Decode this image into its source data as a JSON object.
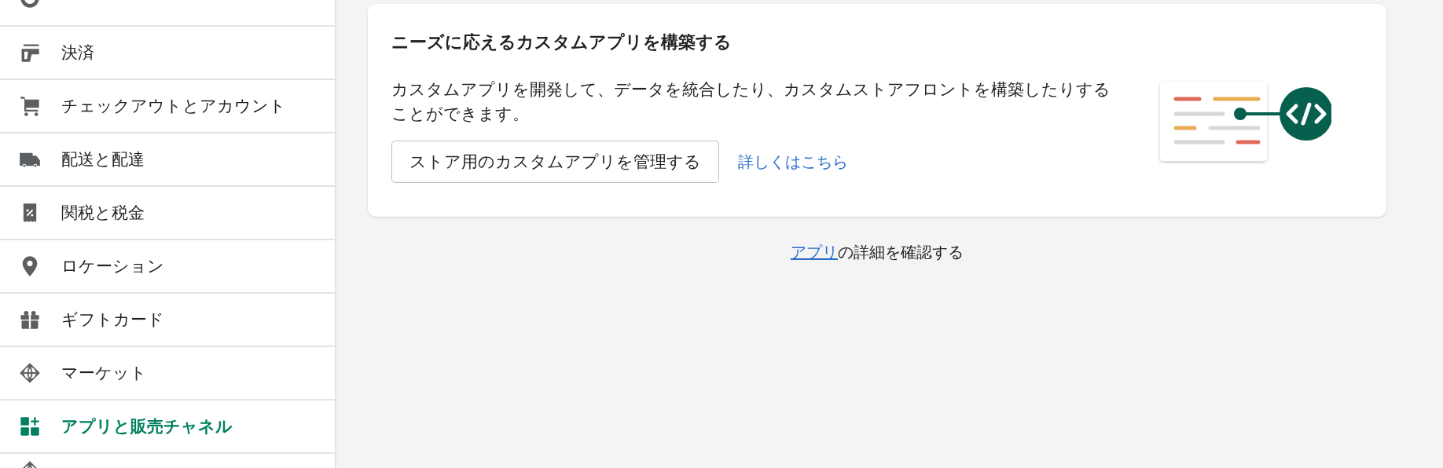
{
  "sidebar": {
    "items": [
      {
        "kind": "user"
      },
      {
        "kind": "card",
        "label": "決済",
        "selected": false
      },
      {
        "kind": "cart",
        "label": "チェックアウトとアカウント",
        "selected": false
      },
      {
        "kind": "truck",
        "label": "配送と配達",
        "selected": false
      },
      {
        "kind": "receipt",
        "label": "関税と税金",
        "selected": false
      },
      {
        "kind": "pin",
        "label": "ロケーション",
        "selected": false
      },
      {
        "kind": "gift",
        "label": "ギフトカード",
        "selected": false
      },
      {
        "kind": "globe",
        "label": "マーケット",
        "selected": false
      },
      {
        "kind": "apps",
        "label": "アプリと販売チャネル",
        "selected": true
      },
      {
        "kind": "globe2"
      }
    ]
  },
  "card": {
    "title": "ニーズに応えるカスタムアプリを構築する",
    "description": "カスタムアプリを開発して、データを統合したり、カスタムストアフロントを構築したりすることができます。",
    "button": "ストア用のカスタムアプリを管理する",
    "link": "詳しくはこちら"
  },
  "footer": {
    "link": "アプリ",
    "text": "の詳細を確認する"
  }
}
